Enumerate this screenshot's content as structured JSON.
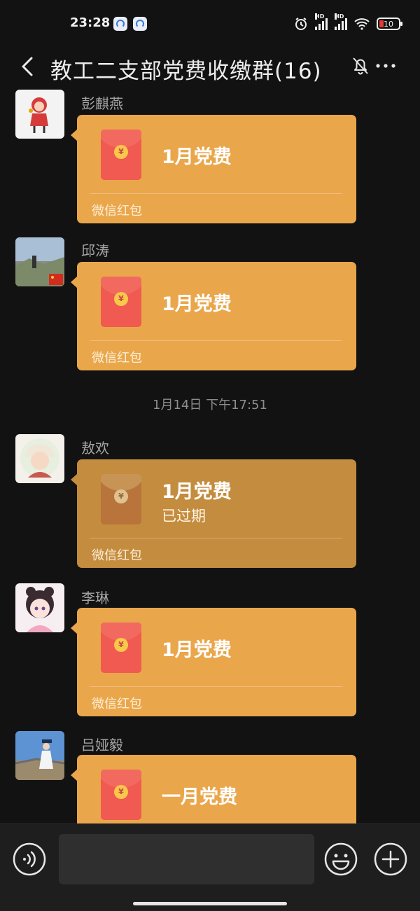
{
  "status_bar": {
    "time": "23:28",
    "network_label": "HD",
    "battery": "10"
  },
  "nav": {
    "title": "教工二支部党费收缴群(16)"
  },
  "messages": [
    {
      "sender": "彭麒燕",
      "title": "1月党费",
      "label": "微信红包"
    },
    {
      "sender": "邱涛",
      "title": "1月党费",
      "label": "微信红包"
    },
    {
      "sender": "敖欢",
      "title": "1月党费",
      "status": "已过期",
      "label": "微信红包"
    },
    {
      "sender": "李琳",
      "title": "1月党费",
      "label": "微信红包"
    },
    {
      "sender": "吕娅毅",
      "title": "一月党费"
    }
  ],
  "timestamp": "1月14日 下午17:51",
  "envelope_coin": "¥",
  "colors": {
    "packet": "#eaa64b",
    "packet_expired": "#c48c3e",
    "envelope": "#f05a50",
    "background": "#121212"
  }
}
